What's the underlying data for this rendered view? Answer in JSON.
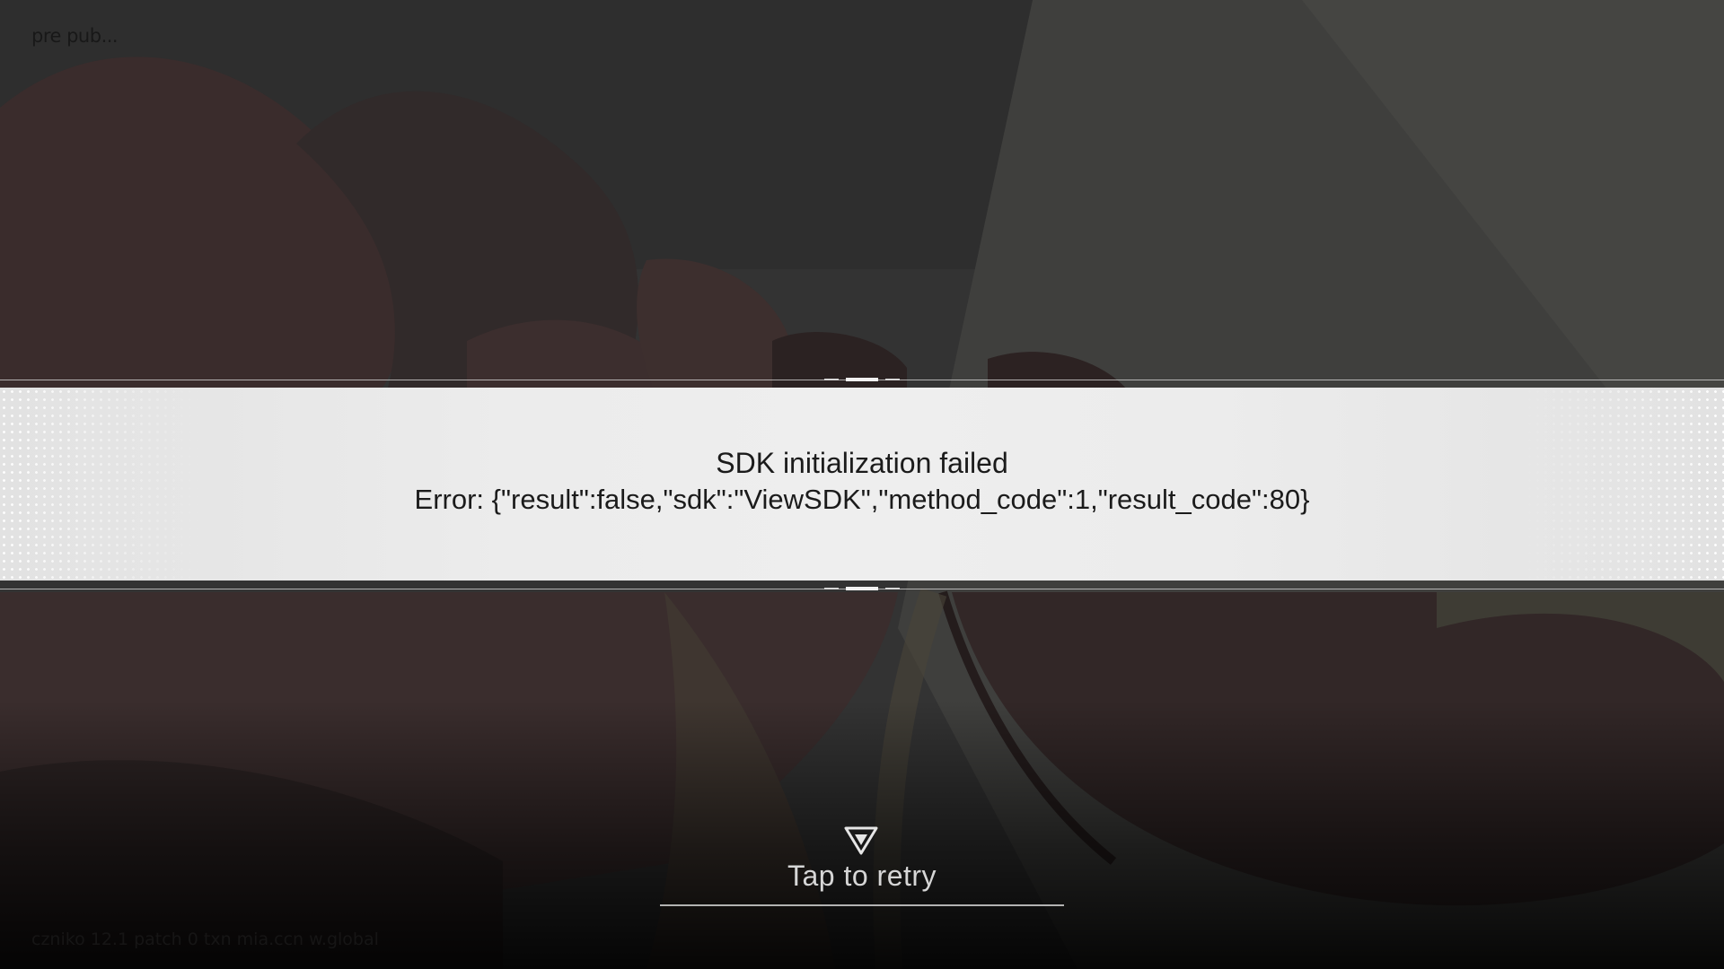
{
  "build_tag": "pre pub...",
  "version_line": "czniko 12.1 patch 0 txn mia.ccn w.global",
  "error": {
    "title": "SDK initialization failed",
    "detail": "Error: {\"result\":false,\"sdk\":\"ViewSDK\",\"method_code\":1,\"result_code\":80}"
  },
  "retry": {
    "label": "Tap to retry",
    "icon": "down-triangle-icon"
  },
  "colors": {
    "banner": "#ececec",
    "text_dark": "#1b1b1b",
    "retry_text": "#d6d6d6"
  }
}
